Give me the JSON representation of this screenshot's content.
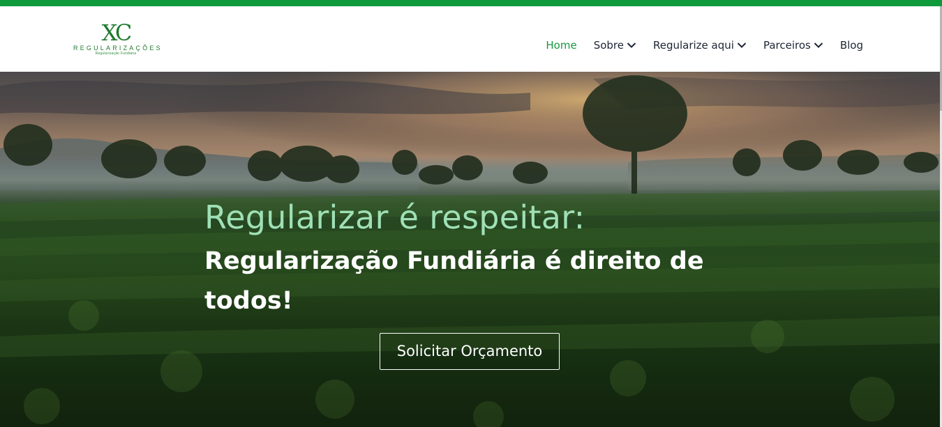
{
  "colors": {
    "accent": "#149a3e",
    "topbar": "#0e9a3a",
    "hero_title": "#9fe0b6",
    "nav_text": "#1d2433"
  },
  "logo": {
    "mark": "XC",
    "name": "REGULARIZAÇÕES",
    "tagline": "Regularização Fundiária"
  },
  "nav": {
    "items": [
      {
        "label": "Home",
        "active": true,
        "dropdown": false
      },
      {
        "label": "Sobre",
        "active": false,
        "dropdown": true
      },
      {
        "label": "Regularize aqui",
        "active": false,
        "dropdown": true
      },
      {
        "label": "Parceiros",
        "active": false,
        "dropdown": true
      },
      {
        "label": "Blog",
        "active": false,
        "dropdown": false
      }
    ],
    "dropdown_icon": "chevron-down-icon"
  },
  "hero": {
    "title": "Regularizar é respeitar:",
    "subtitle": "Regularização Fundiária é direito de todos!",
    "cta_label": "Solicitar Orçamento"
  }
}
